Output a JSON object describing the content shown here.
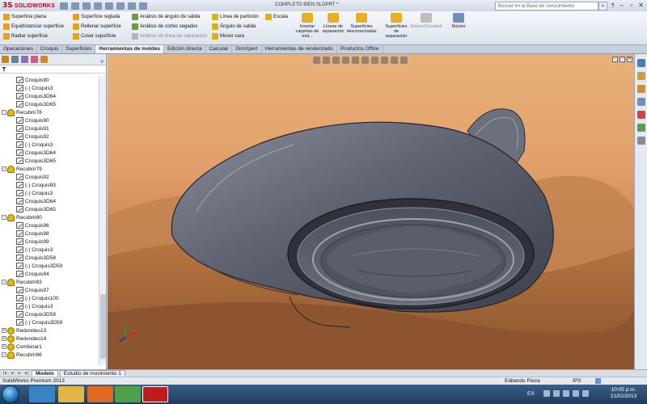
{
  "app": {
    "logo_text": "SOLIDWORKS",
    "document_title": "COMPLETO BIEN.SLDPRT *",
    "search_placeholder": "Buscar en la Base de conocimiento"
  },
  "ribbon": {
    "col1": [
      "Superficie plana",
      "Equidistanciar superficie",
      "Radiar superficie"
    ],
    "col2": [
      "Superficie reglada",
      "Rellenar superficie",
      "Coser superficie"
    ],
    "col3": [
      "Análisis de ángulo de salida",
      "Análisis de cortes segados",
      "Análisis de línea de separación"
    ],
    "col4": [
      "Línea de partición",
      "Ángulo de salida",
      "Mover cara"
    ],
    "col5": [
      "Escala"
    ],
    "big_buttons": [
      {
        "label": "Insertar carpetas de mol...",
        "enabled": true
      },
      {
        "label": "Líneas de separación",
        "enabled": true
      },
      {
        "label": "Superficies desconectadas",
        "enabled": true
      },
      {
        "label": "Superficies de separación",
        "enabled": true
      },
      {
        "label": "Núcleo/Cavidad",
        "enabled": false
      },
      {
        "label": "Núcleo",
        "enabled": true
      }
    ]
  },
  "tabs": [
    "Operaciones",
    "Croquis",
    "Superficies",
    "Herramientas de moldes",
    "Edición directa",
    "Calcular",
    "DimXpert",
    "Herramientas de renderizado",
    "Productos Office"
  ],
  "active_tab": "Herramientas de moldes",
  "tree": [
    {
      "type": "sketch",
      "label": "Croquis90",
      "level": 2
    },
    {
      "type": "sketch",
      "label": "(-) Croquis3",
      "level": 2
    },
    {
      "type": "sketch",
      "label": "Croquis3D64",
      "level": 2
    },
    {
      "type": "sketch",
      "label": "Croquis3D65",
      "level": 2
    },
    {
      "type": "feature",
      "label": "Recubrir78",
      "level": 1
    },
    {
      "type": "sketch",
      "label": "Croquis90",
      "level": 2
    },
    {
      "type": "sketch",
      "label": "Croquis91",
      "level": 2
    },
    {
      "type": "sketch",
      "label": "Croquis92",
      "level": 2
    },
    {
      "type": "sketch",
      "label": "(-) Croquis3",
      "level": 2
    },
    {
      "type": "sketch",
      "label": "Croquis3D64",
      "level": 2
    },
    {
      "type": "sketch",
      "label": "Croquis3D65",
      "level": 2
    },
    {
      "type": "feature",
      "label": "Recubrir79",
      "level": 1
    },
    {
      "type": "sketch",
      "label": "Croquis92",
      "level": 2
    },
    {
      "type": "sketch",
      "label": "(-) Croquis93",
      "level": 2
    },
    {
      "type": "sketch",
      "label": "(-) Croquis3",
      "level": 2
    },
    {
      "type": "sketch",
      "label": "Croquis3D64",
      "level": 2
    },
    {
      "type": "sketch",
      "label": "Croquis3D65",
      "level": 2
    },
    {
      "type": "feature",
      "label": "Recubrir80",
      "level": 1
    },
    {
      "type": "sketch",
      "label": "Croquis96",
      "level": 2
    },
    {
      "type": "sketch",
      "label": "Croquis98",
      "level": 2
    },
    {
      "type": "sketch",
      "label": "Croquis99",
      "level": 2
    },
    {
      "type": "sketch",
      "label": "(-) Croquis3",
      "level": 2
    },
    {
      "type": "sketch",
      "label": "Croquis3D58",
      "level": 2
    },
    {
      "type": "sketch",
      "label": "(-) Croquis3D59",
      "level": 2
    },
    {
      "type": "sketch",
      "label": "Croquis94",
      "level": 2
    },
    {
      "type": "feature",
      "label": "Recubrir83",
      "level": 1
    },
    {
      "type": "sketch",
      "label": "Croquis97",
      "level": 2
    },
    {
      "type": "sketch",
      "label": "(-) Croquis100",
      "level": 2
    },
    {
      "type": "sketch",
      "label": "(-) Croquis3",
      "level": 2
    },
    {
      "type": "sketch",
      "label": "Croquis3D58",
      "level": 2
    },
    {
      "type": "sketch",
      "label": "(-) Croquis3D59",
      "level": 2
    },
    {
      "type": "round",
      "label": "Redondeo13",
      "level": 0
    },
    {
      "type": "round",
      "label": "Redondeo14",
      "level": 0
    },
    {
      "type": "round",
      "label": "Combinar1",
      "level": 0
    },
    {
      "type": "feature",
      "label": "Recubrir86",
      "level": 0
    }
  ],
  "bottom_tabs": [
    "Modelo",
    "Estudio de movimiento 1"
  ],
  "active_bottom_tab": "Modelo",
  "status": {
    "left": "SolidWorks Premium 2013",
    "mode": "Editando Pieza",
    "units": "IPS"
  },
  "taskbar": {
    "lang": "ES",
    "time": "10:05 p.m.",
    "date": "21/02/2013"
  },
  "colors": {
    "accent": "#c0001a",
    "model": "#5a5f6e"
  }
}
